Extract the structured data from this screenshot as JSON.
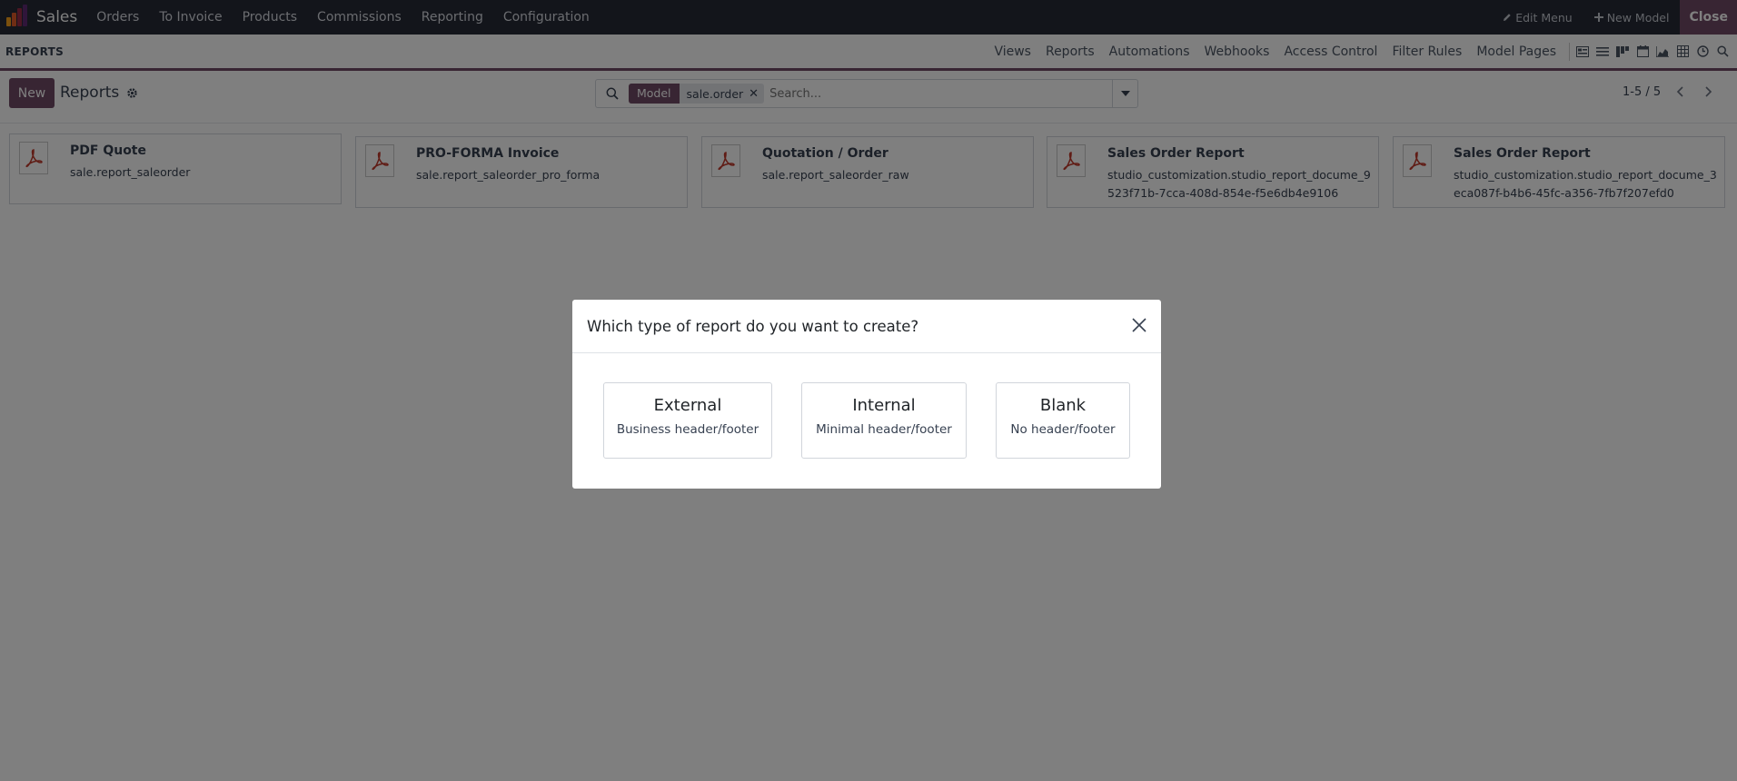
{
  "topnav": {
    "app_name": "Sales",
    "menu": [
      "Orders",
      "To Invoice",
      "Products",
      "Commissions",
      "Reporting",
      "Configuration"
    ],
    "edit_menu": "Edit Menu",
    "new_model": "New Model",
    "close": "Close",
    "logo_colors": [
      "#f7a11a",
      "#e15b29",
      "#9b2d48",
      "#5f2a74"
    ]
  },
  "subbar": {
    "title": "REPORTS",
    "tabs": [
      "Views",
      "Reports",
      "Automations",
      "Webhooks",
      "Access Control",
      "Filter Rules",
      "Model Pages"
    ],
    "view_icons": [
      "form-view-icon",
      "list-view-icon",
      "kanban-view-icon",
      "calendar-view-icon",
      "graph-view-icon",
      "pivot-view-icon",
      "activity-view-icon",
      "search-view-icon"
    ]
  },
  "control": {
    "new_label": "New",
    "breadcrumb": "Reports",
    "facet_label": "Model",
    "facet_value": "sale.order",
    "search_placeholder": "Search...",
    "pager": "1-5 / 5"
  },
  "reports": [
    {
      "title": "PDF Quote",
      "tech": "sale.report_saleorder"
    },
    {
      "title": "PRO-FORMA Invoice",
      "tech": "sale.report_saleorder_pro_forma"
    },
    {
      "title": "Quotation / Order",
      "tech": "sale.report_saleorder_raw"
    },
    {
      "title": "Sales Order Report",
      "tech": "studio_customization.studio_report_docume_9523f71b-7cca-408d-854e-f5e6db4e9106"
    },
    {
      "title": "Sales Order Report",
      "tech": "studio_customization.studio_report_docume_3eca087f-b4b6-45fc-a356-7fb7f207efd0"
    }
  ],
  "modal": {
    "title": "Which type of report do you want to create?",
    "options": [
      {
        "name": "External",
        "desc": "Business header/footer"
      },
      {
        "name": "Internal",
        "desc": "Minimal header/footer"
      },
      {
        "name": "Blank",
        "desc": "No header/footer"
      }
    ]
  },
  "colors": {
    "brand": "#714b67",
    "navbar": "#262a36",
    "pdf_red": "#c0392b"
  }
}
